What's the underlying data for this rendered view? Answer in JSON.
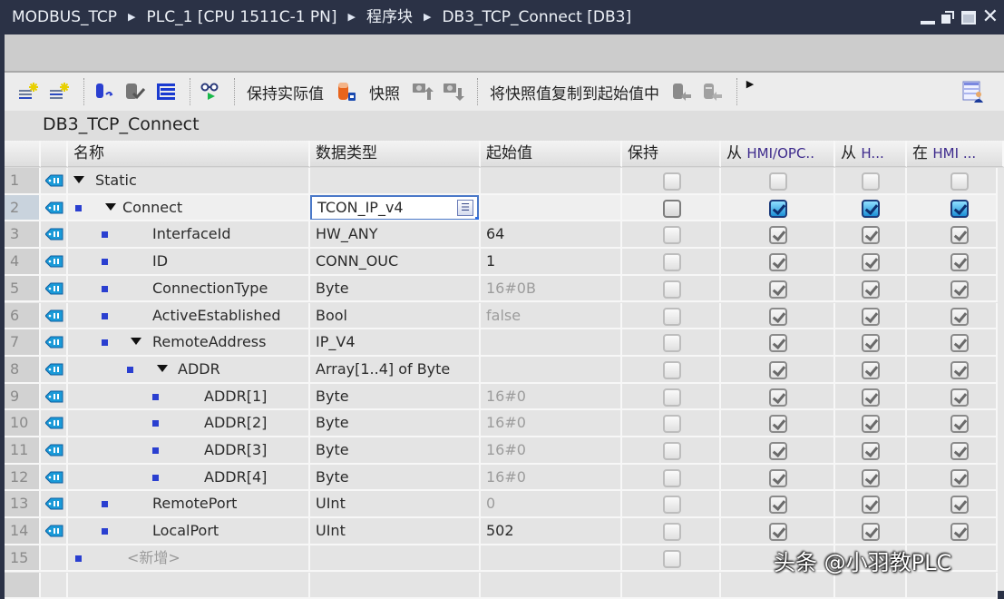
{
  "titlebar": {
    "breadcrumb": [
      "MODBUS_TCP",
      "PLC_1 [CPU 1511C-1 PN]",
      "程序块",
      "DB3_TCP_Connect [DB3]"
    ],
    "controls": [
      "minimize-icon",
      "restore-icon",
      "maximize-icon",
      "close-icon"
    ]
  },
  "toolbar": {
    "keep_actual_values": "保持实际值",
    "snapshot": "快照",
    "copy_snapshot_to_start": "将快照值复制到起始值中",
    "icons": [
      "insert-row-icon",
      "add-row-icon",
      "reset-start-values-icon",
      "update-interface-icon",
      "expanded-mode-icon",
      "monitor-icon",
      "snapshot-db-icon",
      "load-snapshot-icon",
      "save-snapshot-icon",
      "copy-start-values-icon",
      "copy-setpoint-icon",
      "more-icon",
      "layout-settings-icon"
    ]
  },
  "db_title": "DB3_TCP_Connect",
  "columns": {
    "name": "名称",
    "data_type": "数据类型",
    "start_value": "起始值",
    "retain": "保持",
    "hmi1_prefix": "从",
    "hmi1": "HMI/OPC..",
    "hmi2_prefix": "从",
    "hmi2": "H...",
    "hmi3_prefix": "在",
    "hmi3": "HMI ..."
  },
  "rows": [
    {
      "num": "1",
      "name": "Static",
      "type": "",
      "start": "",
      "start_dim": false,
      "retain": false,
      "h1": false,
      "h2": false,
      "h3": false
    },
    {
      "num": "2",
      "name": "Connect",
      "type": "TCON_IP_v4",
      "start": "",
      "start_dim": false,
      "retain": false,
      "h1": true,
      "h2": true,
      "h3": true
    },
    {
      "num": "3",
      "name": "InterfaceId",
      "type": "HW_ANY",
      "start": "64",
      "start_dim": false,
      "retain": false,
      "h1": true,
      "h2": true,
      "h3": true
    },
    {
      "num": "4",
      "name": "ID",
      "type": "CONN_OUC",
      "start": "1",
      "start_dim": false,
      "retain": false,
      "h1": true,
      "h2": true,
      "h3": true
    },
    {
      "num": "5",
      "name": "ConnectionType",
      "type": "Byte",
      "start": "16#0B",
      "start_dim": true,
      "retain": false,
      "h1": true,
      "h2": true,
      "h3": true
    },
    {
      "num": "6",
      "name": "ActiveEstablished",
      "type": "Bool",
      "start": "false",
      "start_dim": true,
      "retain": false,
      "h1": true,
      "h2": true,
      "h3": true
    },
    {
      "num": "7",
      "name": "RemoteAddress",
      "type": "IP_V4",
      "start": "",
      "start_dim": false,
      "retain": false,
      "h1": true,
      "h2": true,
      "h3": true
    },
    {
      "num": "8",
      "name": "ADDR",
      "type": "Array[1..4] of Byte",
      "start": "",
      "start_dim": false,
      "retain": false,
      "h1": true,
      "h2": true,
      "h3": true
    },
    {
      "num": "9",
      "name": "ADDR[1]",
      "type": "Byte",
      "start": "16#0",
      "start_dim": true,
      "retain": false,
      "h1": true,
      "h2": true,
      "h3": true
    },
    {
      "num": "10",
      "name": "ADDR[2]",
      "type": "Byte",
      "start": "16#0",
      "start_dim": true,
      "retain": false,
      "h1": true,
      "h2": true,
      "h3": true
    },
    {
      "num": "11",
      "name": "ADDR[3]",
      "type": "Byte",
      "start": "16#0",
      "start_dim": true,
      "retain": false,
      "h1": true,
      "h2": true,
      "h3": true
    },
    {
      "num": "12",
      "name": "ADDR[4]",
      "type": "Byte",
      "start": "16#0",
      "start_dim": true,
      "retain": false,
      "h1": true,
      "h2": true,
      "h3": true
    },
    {
      "num": "13",
      "name": "RemotePort",
      "type": "UInt",
      "start": "0",
      "start_dim": true,
      "retain": false,
      "h1": true,
      "h2": true,
      "h3": true
    },
    {
      "num": "14",
      "name": "LocalPort",
      "type": "UInt",
      "start": "502",
      "start_dim": false,
      "retain": false,
      "h1": true,
      "h2": true,
      "h3": true
    },
    {
      "num": "15",
      "name": "<新增>",
      "type": "",
      "start": "",
      "start_dim": false,
      "retain": false,
      "h1": false,
      "h2": false,
      "h3": false
    }
  ],
  "watermark": "头条 @小羽教PLC",
  "colors": {
    "titlebar_bg": "#2b3246",
    "hmi_header_text": "#3d2a8c",
    "bullet_blue": "#2a3fd0",
    "selection_border": "#4a78c8"
  }
}
